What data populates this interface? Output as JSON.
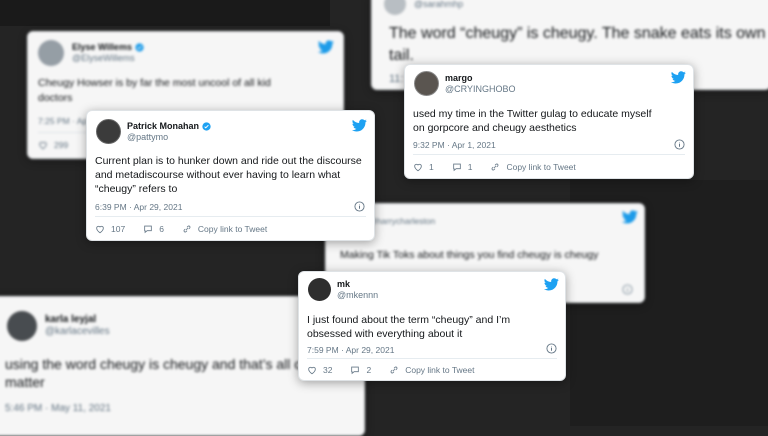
{
  "colors": {
    "background": "#242424",
    "card": "#ffffff",
    "twitter_blue": "#1da1f2",
    "muted": "#657786"
  },
  "tweets": [
    {
      "name": "Elyse Willems",
      "handle": "@ElyseWillems",
      "verified": true,
      "text": "Cheugy Howser is by far the most uncool of all kid doctors",
      "time": "7:25 PM · Ap",
      "likes": "299",
      "replies": "",
      "copy": ""
    },
    {
      "name": "",
      "handle": "@sarahmhp",
      "verified": false,
      "text": "The word “cheugy” is cheugy. The snake eats its own tail.",
      "time": "11:",
      "likes": "",
      "replies": "",
      "copy": ""
    },
    {
      "name": "Patrick Monahan",
      "handle": "@pattymo",
      "verified": true,
      "text": "Current plan is to hunker down and ride out the discourse and metadiscourse without ever having to learn what “cheugy” refers to",
      "time": "6:39 PM · Apr 29, 2021",
      "likes": "107",
      "replies": "6",
      "copy": "Copy link to Tweet"
    },
    {
      "name": "margo",
      "handle": "@CRYINGHOBO",
      "verified": false,
      "text": "used my time in the Twitter gulag to educate myself on gorpcore and cheugy aesthetics",
      "time": "9:32 PM · Apr 1, 2021",
      "likes": "1",
      "replies": "1",
      "copy": "Copy link to Tweet"
    },
    {
      "name": "",
      "handle": "@harrycharleston",
      "verified": false,
      "text": "Making Tik Toks about things you find cheugy is cheugy",
      "time": "",
      "likes": "",
      "replies": "",
      "copy": ""
    },
    {
      "name": "mk",
      "handle": "@mkennn",
      "verified": false,
      "text": "I just found about the term “cheugy” and I’m obsessed with everything about it",
      "time": "7:59 PM · Apr 29, 2021",
      "likes": "32",
      "replies": "2",
      "copy": "Copy link to Tweet"
    },
    {
      "name": "karla leyjal",
      "handle": "@karlacevilles",
      "verified": false,
      "text": "using the word cheugy is cheugy and that’s all on the matter",
      "time": "5:46 PM · May 11, 2021",
      "likes": "",
      "replies": "",
      "copy": ""
    }
  ]
}
